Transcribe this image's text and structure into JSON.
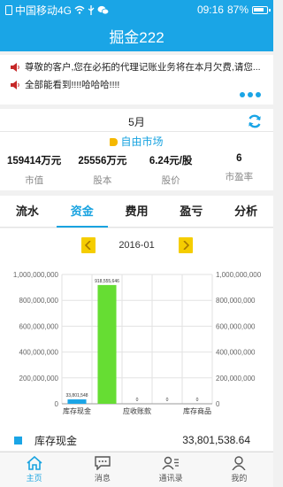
{
  "status_bar": {
    "carrier": "中国移动4G",
    "time": "09:16",
    "battery": "87%"
  },
  "app_title": "掘金222",
  "notices": [
    "尊敬的客户,您在必拓的代理记账业务将在本月欠费,请您...",
    "全部能看到!!!!哈哈哈!!!!"
  ],
  "period_label": "5月",
  "market_label": "自由市场",
  "stats": [
    {
      "value": "159414万元",
      "label": "市值"
    },
    {
      "value": "25556万元",
      "label": "股本"
    },
    {
      "value": "6.24元/股",
      "label": "股价"
    },
    {
      "value": "6",
      "label": "市盈率"
    }
  ],
  "tabs": [
    "流水",
    "资金",
    "费用",
    "盈亏",
    "分析"
  ],
  "active_tab": 1,
  "chart_date": "2016-01",
  "chart_data": {
    "type": "bar",
    "categories": [
      "库存现金",
      "",
      "应收账款",
      "",
      "库存商品"
    ],
    "values": [
      33801548,
      918555646,
      0,
      0,
      0
    ],
    "data_labels": [
      "33,801,548",
      "918,555,646",
      "0",
      "0",
      "0"
    ],
    "colors": [
      "#1aa5e6",
      "#66dd33",
      "#1aa5e6",
      "#1aa5e6",
      "#1aa5e6"
    ],
    "ylim": [
      0,
      1000000000
    ],
    "yticks": [
      "0",
      "200,000,000",
      "400,000,000",
      "600,000,000",
      "800,000,000",
      "1,000,000,000"
    ],
    "ytick_values": [
      0,
      200000000,
      400000000,
      600000000,
      800000000,
      1000000000
    ],
    "grid": true
  },
  "legend": {
    "label": "库存现金",
    "amount": "33,801,538.64",
    "color": "#1aa5e6"
  },
  "bottom_nav": [
    {
      "label": "主页",
      "icon": "home-icon"
    },
    {
      "label": "消息",
      "icon": "chat-icon"
    },
    {
      "label": "通讯录",
      "icon": "contacts-icon"
    },
    {
      "label": "我的",
      "icon": "profile-icon"
    }
  ]
}
